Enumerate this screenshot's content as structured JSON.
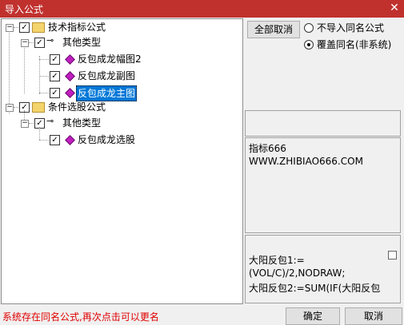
{
  "window": {
    "title": "导入公式",
    "close_glyph": "✕"
  },
  "tree": {
    "root1": {
      "label": "技术指标公式",
      "type": "其他类型",
      "items": [
        "反包成龙幅图2",
        "反包成龙副图",
        "反包成龙主图"
      ]
    },
    "root2": {
      "label": "条件选股公式",
      "type": "其他类型",
      "items": [
        "反包成龙选股"
      ]
    }
  },
  "controls": {
    "cancel_all": "全部取消",
    "option_no_import": "不导入同名公式",
    "option_overwrite": "覆盖同名(非系统)",
    "selected_option": "option_overwrite"
  },
  "info_panel": {
    "line1": "指标666",
    "line2": "WWW.ZHIBIAO666.COM"
  },
  "code_panel": {
    "line1": "大阳反包1:=",
    "line2": "(VOL/C)/2,NODRAW;",
    "line3": "大阳反包2:=SUM(IF(大阳反包"
  },
  "status": "系统存在同名公式,再次点击可以更名",
  "buttons": {
    "ok": "确定",
    "cancel": "取消"
  }
}
